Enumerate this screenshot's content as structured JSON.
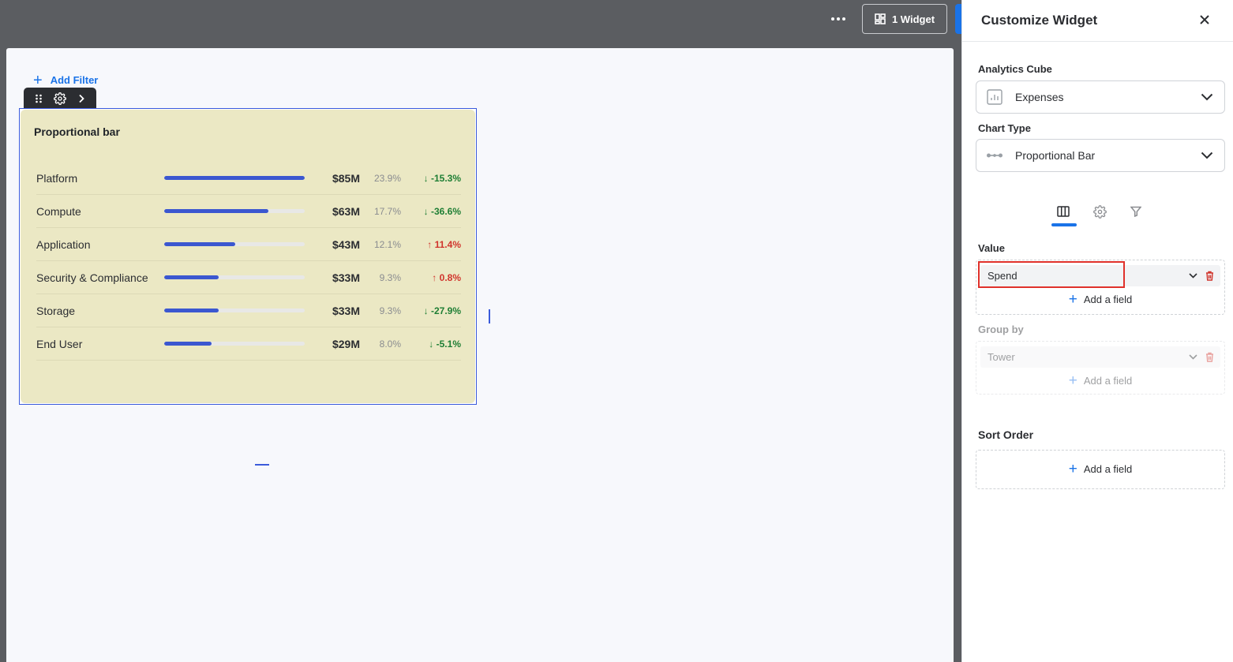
{
  "topbar": {
    "more_icon": "more-horizontal-icon",
    "widget_button_label": "1 Widget",
    "widget_button_icon": "dashboard-grid-icon"
  },
  "canvas": {
    "add_filter_label": "Add Filter",
    "widget_toolbar": {
      "icons": [
        "drag-handle-icon",
        "gear-icon",
        "chevron-right-icon"
      ]
    },
    "widget": {
      "title": "Proportional bar",
      "background": "#ebe8c4",
      "bar_color": "#3b57d0"
    }
  },
  "chart_data": {
    "type": "bar",
    "title": "Proportional bar",
    "rows": [
      {
        "label": "Platform",
        "value": "$85M",
        "share": 23.9,
        "share_label": "23.9%",
        "delta": "-15.3%",
        "direction": "down"
      },
      {
        "label": "Compute",
        "value": "$63M",
        "share": 17.7,
        "share_label": "17.7%",
        "delta": "-36.6%",
        "direction": "down"
      },
      {
        "label": "Application",
        "value": "$43M",
        "share": 12.1,
        "share_label": "12.1%",
        "delta": "11.4%",
        "direction": "up"
      },
      {
        "label": "Security & Compliance",
        "value": "$33M",
        "share": 9.3,
        "share_label": "9.3%",
        "delta": "0.8%",
        "direction": "up"
      },
      {
        "label": "Storage",
        "value": "$33M",
        "share": 9.3,
        "share_label": "9.3%",
        "delta": "-27.9%",
        "direction": "down"
      },
      {
        "label": "End User",
        "value": "$29M",
        "share": 8.0,
        "share_label": "8.0%",
        "delta": "-5.1%",
        "direction": "down"
      }
    ],
    "positive_color": "#1e7e34",
    "negative_color": "#d0342c"
  },
  "panel": {
    "title": "Customize Widget",
    "close_icon": "close-icon",
    "analytics_cube": {
      "label": "Analytics Cube",
      "value": "Expenses",
      "icon": "bar-chart-icon"
    },
    "chart_type": {
      "label": "Chart Type",
      "value": "Proportional Bar",
      "icon": "proportional-bar-icon"
    },
    "tabs": [
      {
        "name": "columns",
        "icon": "columns-icon",
        "active": true
      },
      {
        "name": "settings",
        "icon": "gear-icon",
        "active": false
      },
      {
        "name": "filter",
        "icon": "filter-icon",
        "active": false
      }
    ],
    "value_section": {
      "label": "Value",
      "field": "Spend",
      "add_field_label": "Add a field"
    },
    "group_by_section": {
      "label": "Group by",
      "field": "Tower",
      "add_field_label": "Add a field"
    },
    "sort_order_section": {
      "label": "Sort Order",
      "add_field_label": "Add a field"
    },
    "accent_color": "#1a73e8",
    "highlight_color": "#e0312b"
  }
}
